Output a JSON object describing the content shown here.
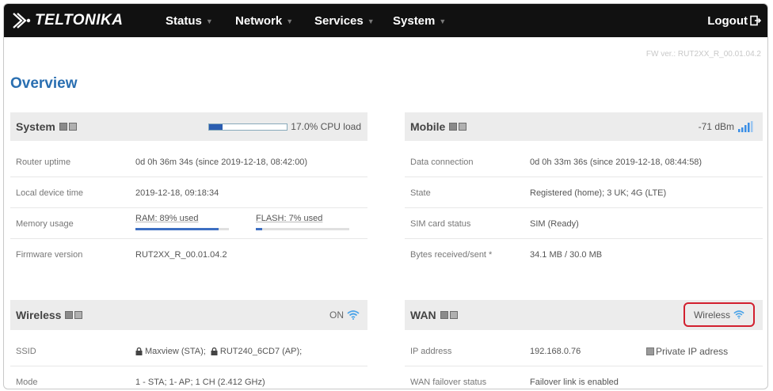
{
  "brand": {
    "name": "TELTONIKA",
    "logo_icon": "teltonika-wing-icon"
  },
  "nav": {
    "items": [
      {
        "label": "Status"
      },
      {
        "label": "Network"
      },
      {
        "label": "Services"
      },
      {
        "label": "System"
      }
    ],
    "logout_label": "Logout"
  },
  "fw_version": "FW ver.: RUT2XX_R_00.01.04.2",
  "page_title": "Overview",
  "system": {
    "title": "System",
    "cpu_label": "17.0% CPU load",
    "cpu_fraction": 0.17,
    "rows": {
      "uptime": {
        "label": "Router uptime",
        "value": "0d 0h 36m 34s (since 2019-12-18, 08:42:00)"
      },
      "time": {
        "label": "Local device time",
        "value": "2019-12-18, 09:18:34"
      },
      "memory": {
        "label": "Memory usage",
        "ram": "RAM: 89% used",
        "ram_fraction": 0.89,
        "flash": "FLASH: 7% used",
        "flash_fraction": 0.07
      },
      "firmware": {
        "label": "Firmware version",
        "value": "RUT2XX_R_00.01.04.2"
      }
    }
  },
  "mobile": {
    "title": "Mobile",
    "signal": "-71 dBm",
    "rows": {
      "conn": {
        "label": "Data connection",
        "value": "0d 0h 33m 36s (since 2019-12-18, 08:44:58)"
      },
      "state": {
        "label": "State",
        "value": "Registered (home); 3 UK; 4G (LTE)"
      },
      "sim": {
        "label": "SIM card status",
        "value": "SIM (Ready)"
      },
      "bytes": {
        "label": "Bytes received/sent *",
        "value": "34.1 MB / 30.0 MB"
      }
    }
  },
  "wireless": {
    "title": "Wireless",
    "status": "ON",
    "rows": {
      "ssid": {
        "label": "SSID",
        "value_sta": "Maxview (STA);",
        "value_ap": "RUT240_6CD7 (AP);"
      },
      "mode": {
        "label": "Mode",
        "value": "1 - STA; 1- AP; 1 CH (2.412 GHz)"
      }
    }
  },
  "wan": {
    "title": "WAN",
    "status": "Wireless",
    "rows": {
      "ip": {
        "label": "IP address",
        "value": "192.168.0.76",
        "link": "Private IP adress"
      },
      "failover": {
        "label": "WAN failover status",
        "value": "Failover link is enabled"
      }
    }
  },
  "colors": {
    "accent": "#2a6fb1",
    "highlight": "#d2202f",
    "topbar": "#111111"
  }
}
